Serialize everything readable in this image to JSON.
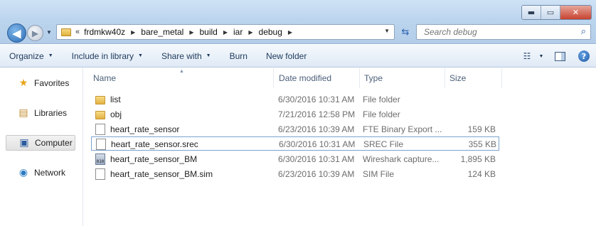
{
  "window": {
    "caption": {
      "minimize": "▬",
      "maximize": "▭",
      "close": "✕"
    }
  },
  "nav": {
    "back_icon": "◀",
    "forward_icon": "▶",
    "history_dropdown": "▼"
  },
  "address": {
    "overflow": "«",
    "crumbs": [
      "frdmkw40z",
      "bare_metal",
      "build",
      "iar",
      "debug"
    ],
    "separator": "▶",
    "dropdown": "▼"
  },
  "refresh_icon": "⇆",
  "search": {
    "placeholder": "Search debug",
    "value": ""
  },
  "commands": {
    "organize": "Organize",
    "include_in_library": "Include in library",
    "share_with": "Share with",
    "burn": "Burn",
    "new_folder": "New folder",
    "dropdown": "▼"
  },
  "sidebar": {
    "items": [
      {
        "label": "Favorites",
        "icon": "star-icon"
      },
      {
        "label": "Libraries",
        "icon": "library-icon"
      },
      {
        "label": "Computer",
        "icon": "computer-icon"
      },
      {
        "label": "Network",
        "icon": "network-icon"
      }
    ]
  },
  "columns": {
    "name": "Name",
    "date": "Date modified",
    "type": "Type",
    "size": "Size"
  },
  "files": [
    {
      "name": "list",
      "date": "6/30/2016 10:31 AM",
      "type": "File folder",
      "size": "",
      "icon": "folder-icon"
    },
    {
      "name": "obj",
      "date": "7/21/2016 12:58 PM",
      "type": "File folder",
      "size": "",
      "icon": "folder-icon"
    },
    {
      "name": "heart_rate_sensor",
      "date": "6/23/2016 10:39 AM",
      "type": "FTE Binary Export ...",
      "size": "159 KB",
      "icon": "file-icon"
    },
    {
      "name": "heart_rate_sensor.srec",
      "date": "6/30/2016 10:31 AM",
      "type": "SREC File",
      "size": "355 KB",
      "icon": "file-icon"
    },
    {
      "name": "heart_rate_sensor_BM",
      "date": "6/30/2016 10:31 AM",
      "type": "Wireshark capture...",
      "size": "1,895 KB",
      "icon": "wireshark-capture-icon"
    },
    {
      "name": "heart_rate_sensor_BM.sim",
      "date": "6/23/2016 10:39 AM",
      "type": "SIM File",
      "size": "124 KB",
      "icon": "file-icon"
    }
  ],
  "colors": {
    "accent": "#2b5c9e",
    "titlebar": "#bcd5ee",
    "command_text": "#1e395b"
  }
}
